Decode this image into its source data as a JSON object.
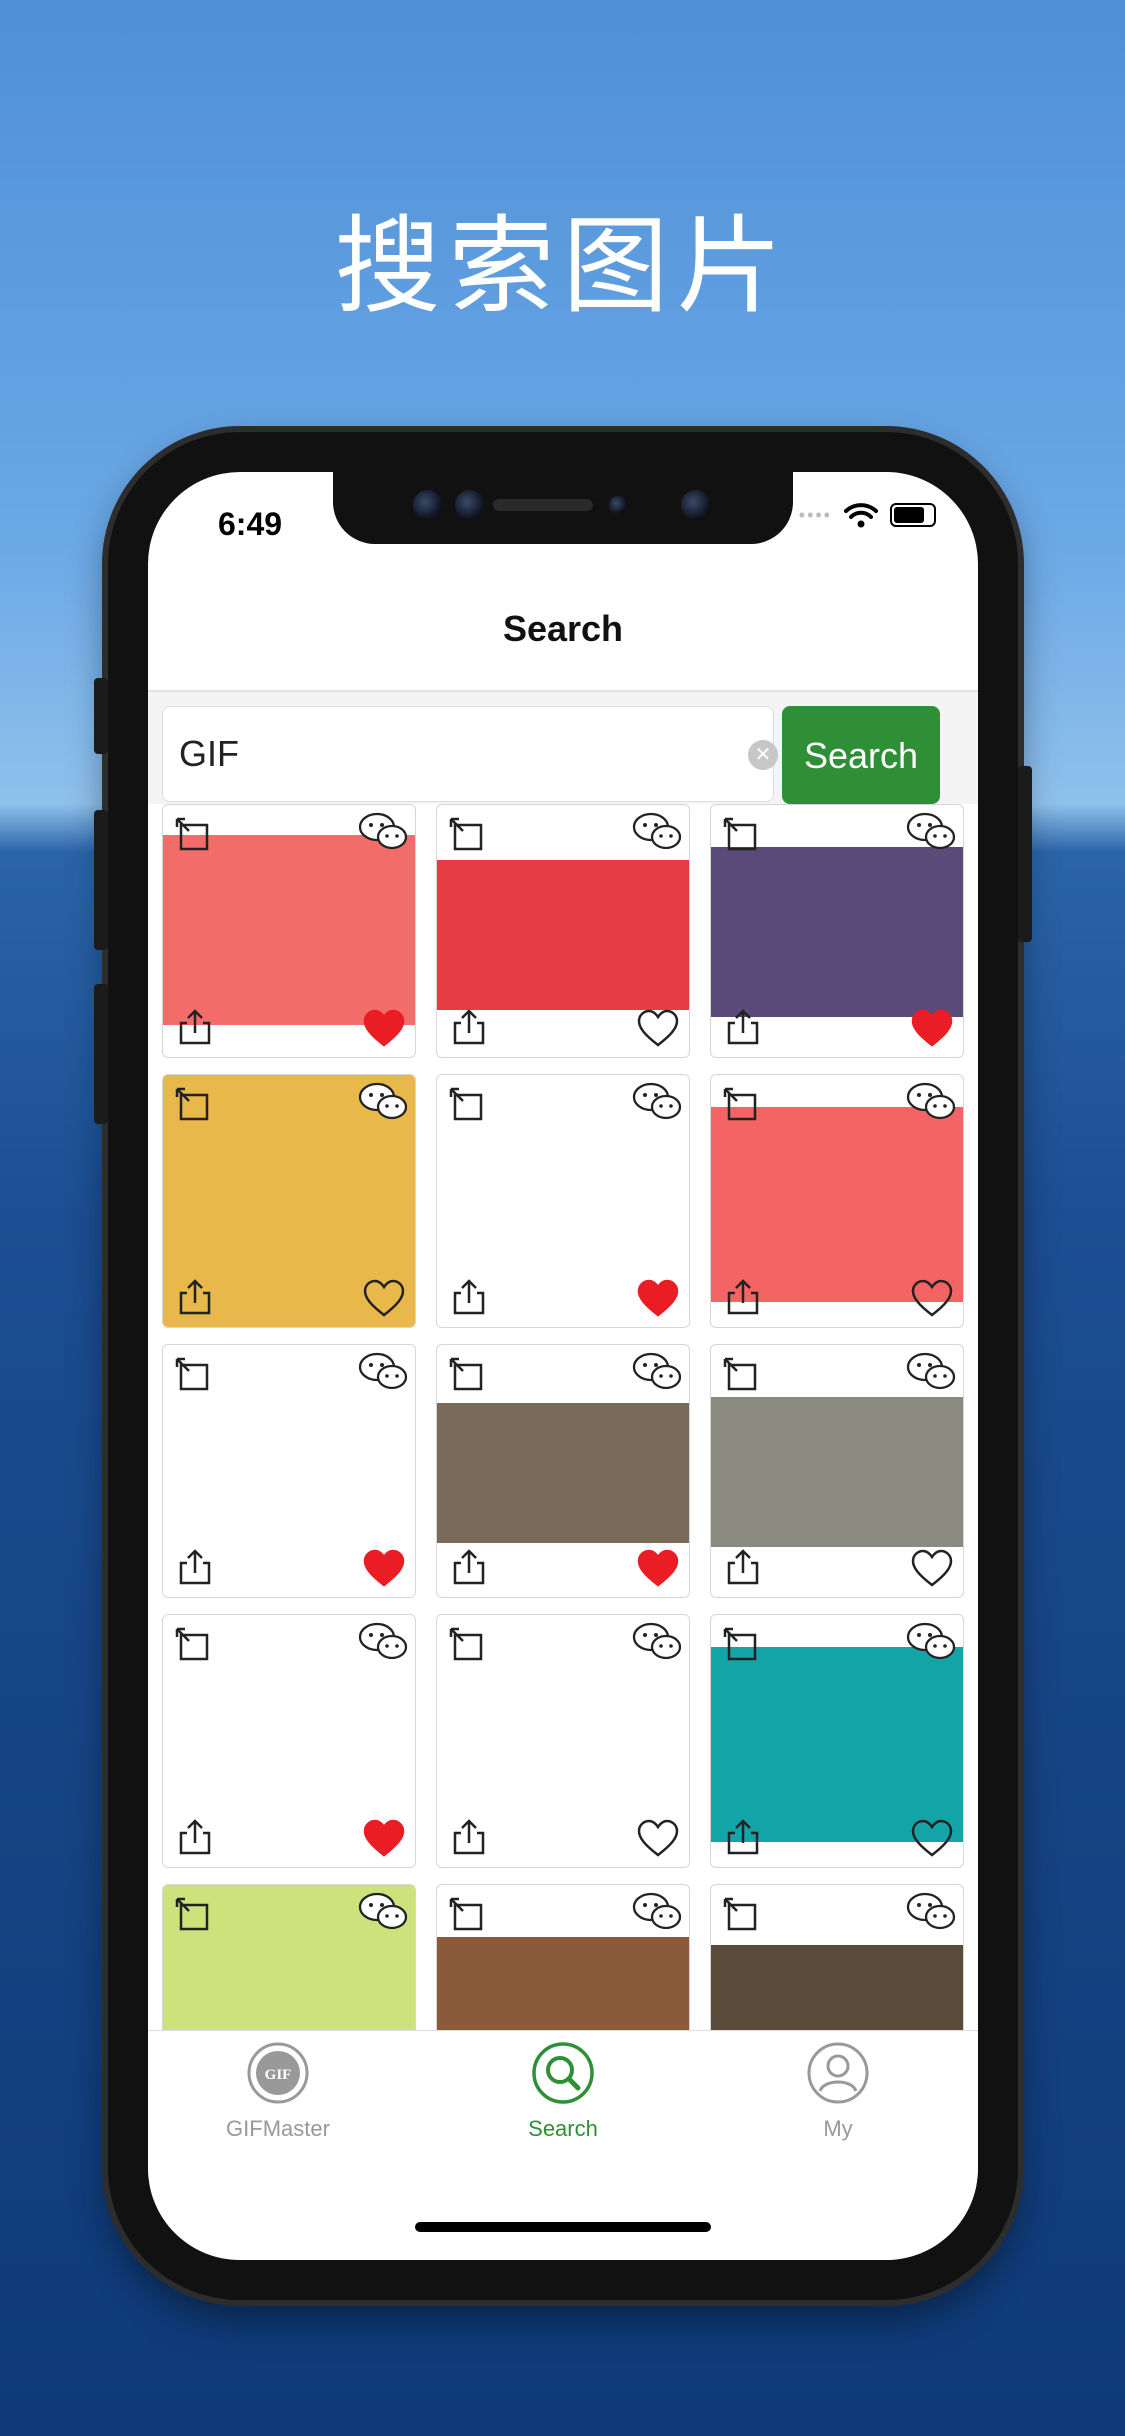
{
  "headline": "搜索图片",
  "status_bar": {
    "time": "6:49",
    "battery_percent": 80
  },
  "nav": {
    "title": "Search"
  },
  "search": {
    "value": "GIF",
    "button_label": "Search"
  },
  "grid": {
    "cards": [
      {
        "bg": "#f26c6a",
        "favorited": true
      },
      {
        "bg": "#e63c44",
        "favorited": false
      },
      {
        "bg": "#5a4a7a",
        "favorited": true
      },
      {
        "bg": "#e8b84a",
        "favorited": false
      },
      {
        "bg": "#ffffff",
        "favorited": true
      },
      {
        "bg": "#f46464",
        "favorited": false
      },
      {
        "bg": "#ffffff",
        "favorited": true
      },
      {
        "bg": "#7a6a5a",
        "favorited": true
      },
      {
        "bg": "#8a8a80",
        "favorited": false
      },
      {
        "bg": "#ffffff",
        "favorited": true
      },
      {
        "bg": "#ffffff",
        "favorited": false
      },
      {
        "bg": "#13a4a8",
        "favorited": false
      },
      {
        "bg": "#cde27a",
        "favorited": false
      },
      {
        "bg": "#8a5a3a",
        "favorited": false
      },
      {
        "bg": "#5a4a3a",
        "favorited": false
      }
    ]
  },
  "tabbar": {
    "tabs": [
      {
        "label": "GIFMaster",
        "active": false
      },
      {
        "label": "Search",
        "active": true
      },
      {
        "label": "My",
        "active": false
      }
    ],
    "gif_glyph": "GIF"
  },
  "colors": {
    "accent": "#2f8f36",
    "heart": "#ea1c24",
    "inactive": "#999999"
  }
}
